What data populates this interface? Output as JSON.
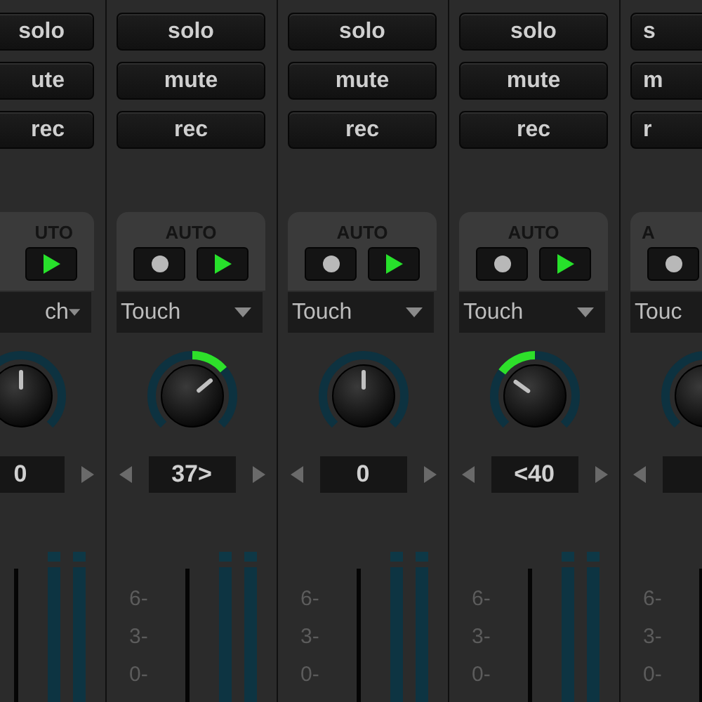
{
  "strips": [
    {
      "buttons": [
        "solo",
        "ute",
        "rec"
      ],
      "auto_label": "UTO",
      "automation_mode": "ch",
      "pan_value": "0"
    },
    {
      "buttons": [
        "solo",
        "mute",
        "rec"
      ],
      "auto_label": "AUTO",
      "automation_mode": "Touch",
      "pan_value": "37>",
      "scale": [
        "6-",
        "3-",
        "0-"
      ]
    },
    {
      "buttons": [
        "solo",
        "mute",
        "rec"
      ],
      "auto_label": "AUTO",
      "automation_mode": "Touch",
      "pan_value": "0",
      "scale": [
        "6-",
        "3-",
        "0-"
      ]
    },
    {
      "buttons": [
        "solo",
        "mute",
        "rec"
      ],
      "auto_label": "AUTO",
      "automation_mode": "Touch",
      "pan_value": "<40",
      "scale": [
        "6-",
        "3-",
        "0-"
      ]
    },
    {
      "buttons": [
        "s",
        "m",
        "r"
      ],
      "auto_label": "A",
      "automation_mode": "Touc",
      "scale": [
        "6-",
        "3-",
        "0-"
      ]
    }
  ]
}
